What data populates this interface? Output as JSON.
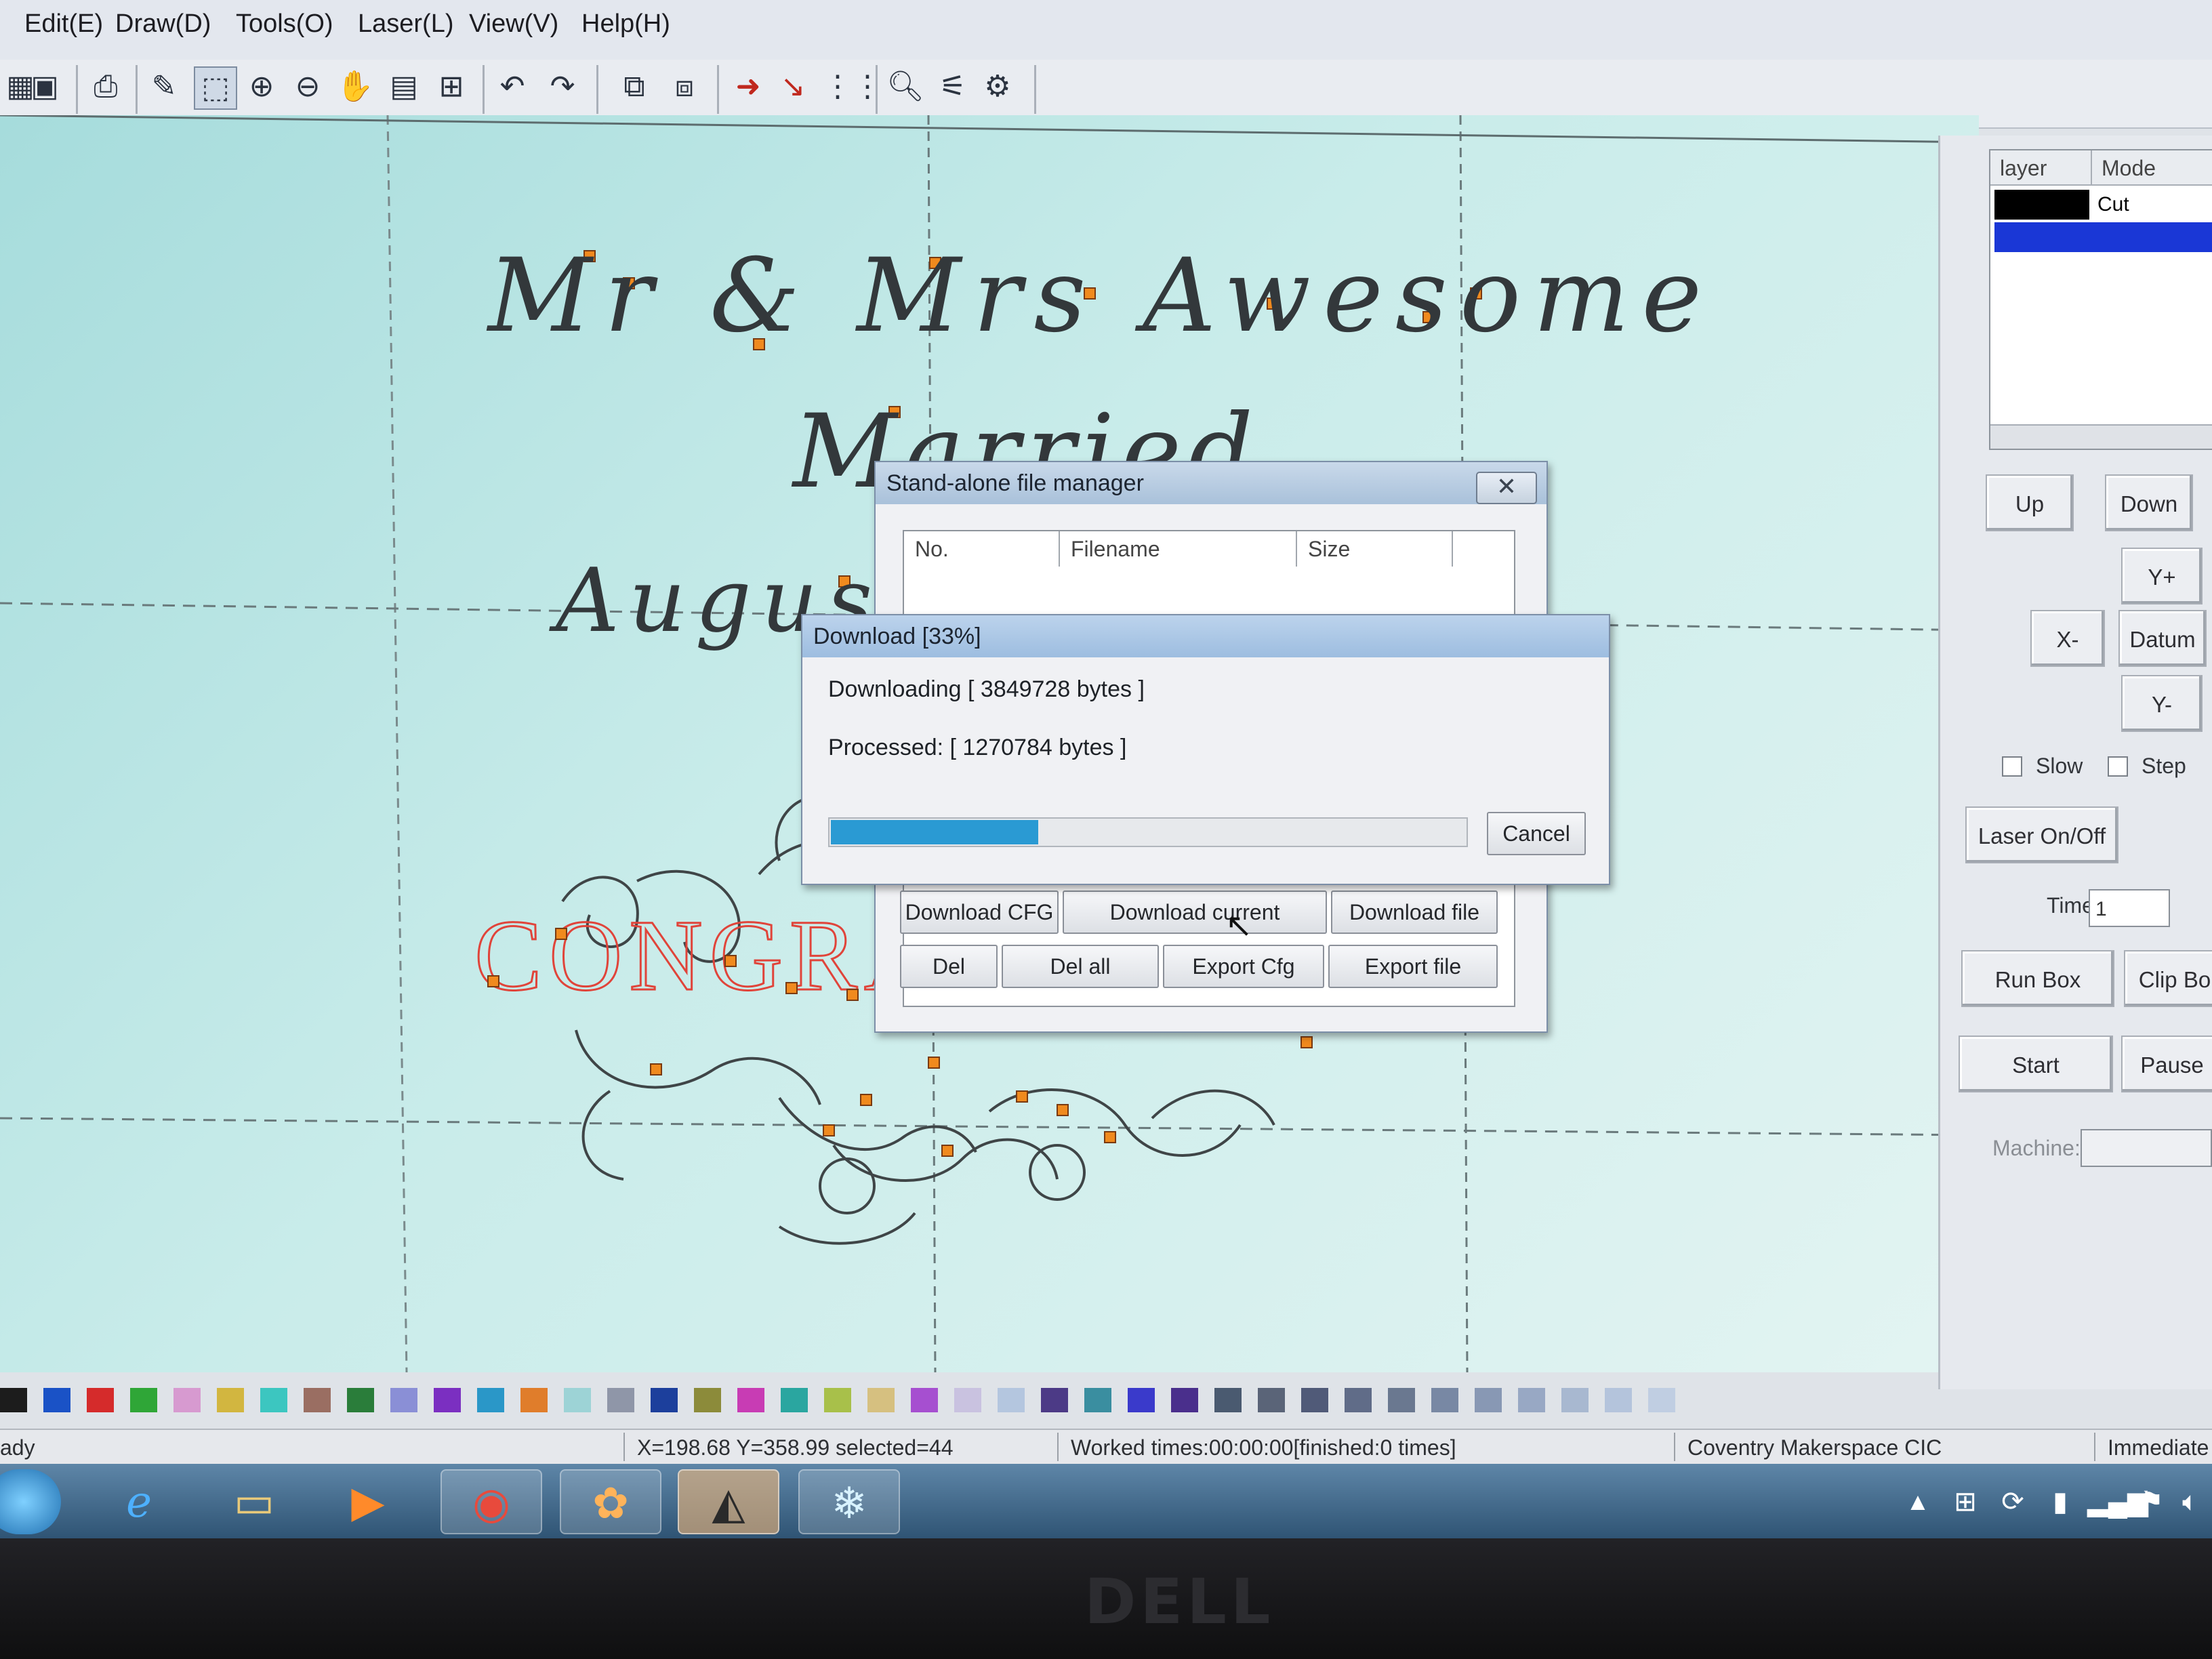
{
  "menu": [
    "Edit(E)",
    "Draw(D)",
    "Tools(O)",
    "Laser(L)",
    "View(V)",
    "Help(H)"
  ],
  "canvas_text": {
    "line1": "Mr & Mrs Awesome",
    "line2": "Married",
    "line3": "August",
    "congrats": "CONGRAT"
  },
  "layers": {
    "col_layer": "layer",
    "col_mode": "Mode",
    "rows": [
      {
        "mode": "Cut",
        "color": "#000000"
      },
      {
        "mode": "",
        "color": "#1a37d6"
      }
    ]
  },
  "panel": {
    "up": "Up",
    "down": "Down",
    "yplus": "Y+",
    "xminus": "X-",
    "datum": "Datum",
    "yminus": "Y-",
    "slow": "Slow",
    "step": "Step",
    "laser": "Laser On/Off",
    "times_label": "Times:",
    "times_value": "1",
    "run_box": "Run Box",
    "clip_box": "Clip Bo",
    "start": "Start",
    "pause": "Pause",
    "machine_label": "Machine:"
  },
  "file_manager": {
    "title": "Stand-alone file manager",
    "columns": [
      "No.",
      "Filename",
      "Size"
    ],
    "buttons_row1": [
      "Download CFG",
      "Download current",
      "Download file"
    ],
    "buttons_row2": [
      "Del",
      "Del all",
      "Export Cfg",
      "Export file"
    ]
  },
  "download": {
    "title": "Download [33%]",
    "downloading": "Downloading [ 3849728 bytes ]",
    "processed": "Processed: [ 1270784 bytes ]",
    "progress": 0.33,
    "cancel": "Cancel"
  },
  "status": {
    "left": "ady",
    "coords": "X=198.68 Y=358.99 selected=44",
    "worked": "Worked times:00:00:00[finished:0 times]",
    "company": "Coventry Makerspace CIC",
    "mode": "Immediate"
  },
  "palette": [
    "#1c1c1c",
    "#1a52c6",
    "#d52b2b",
    "#2fa637",
    "#d79ad0",
    "#d2b640",
    "#3cc6c0",
    "#9a6e62",
    "#2a7d3a",
    "#8a8fd6",
    "#7b2fc1",
    "#2a97c8",
    "#e07d2b",
    "#9dd3d6",
    "#8f96a8",
    "#1c3f9c",
    "#8c8b3a",
    "#c83cb4",
    "#2aa6a0",
    "#a8c04a",
    "#d6c080",
    "#a64fd0",
    "#c9c2e0",
    "#b4c6df",
    "#4c3a86",
    "#3a8ea0",
    "#3a3acb",
    "#4a2f8c",
    "#4a5a70",
    "#5a6478",
    "#505a78",
    "#606c88",
    "#6a7890",
    "#7888a4",
    "#8898b4",
    "#98a8c4",
    "#a8b8d0",
    "#b4c4dc",
    "#c0cee2"
  ],
  "colors": {
    "progress": "#2a9ad3",
    "canvas": "#bfe8e6",
    "taskbar": "#3a6386"
  },
  "icons": [
    "new-icon",
    "save-icon",
    "print-icon",
    "brush-icon",
    "select-icon",
    "zoom-in-icon",
    "zoom-out-icon",
    "pan-icon",
    "page-icon",
    "fit-icon",
    "undo-icon",
    "redo-icon",
    "group-icon",
    "ungroup-icon",
    "arrow-icon",
    "node-icon",
    "grid-icon",
    "preview-icon",
    "laser-head-icon",
    "gear-icon"
  ],
  "taskbar": [
    "start-orb-icon",
    "internet-explorer-icon",
    "file-explorer-icon",
    "media-player-icon",
    "chrome-icon",
    "paint-icon",
    "inkscape-icon",
    "laser-app-icon"
  ]
}
